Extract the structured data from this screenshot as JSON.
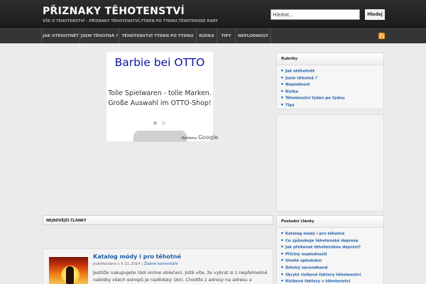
{
  "site": {
    "title": "PŘIZNAKY TĚHOTENSTVÍ",
    "tagline": "VŠE O TEHOTENSTVÍ - PŘÍZNAKY TĚHOTENSTVÍ,TÝDEN PO TÝDNU,TĚHOTENSKÉ RADY"
  },
  "search": {
    "value": "Hledat...",
    "button_label": "Hledej"
  },
  "nav": {
    "items": [
      "JAK OTĚHOTNĚT",
      "JSEM TĚHOTNÁ ?",
      "TĚHOTENSTVÍ TÝDEN PO TÝDNU",
      "RIZIKA",
      "TIPY",
      "NEPLODNOST"
    ],
    "rss_icon": "rss-icon"
  },
  "ad": {
    "title": "Barbie bei OTTO",
    "text": "Tolle Spielwaren - tolle Marken. Große Auswahl im OTTO-Shop!",
    "label": "Reklamy",
    "brand": "Google"
  },
  "sidebar": {
    "rubriky": {
      "title": "Rubriky",
      "items": [
        "Jak otěhotnět",
        "Jsem těhotná ?",
        "Neplodnost",
        "Rizika",
        "Těhotenství týden po týdnu",
        "Tipy"
      ]
    },
    "latest": {
      "title": "Poslední články",
      "items": [
        "Katalog módy i pro těhotné",
        "Co způsobuje těhotenské deprese",
        "Jak překonat těhotenskou depresi?",
        "Příčiny neplodnosti",
        "Umělé oplodnění",
        "Dětský secondhand",
        "Skryté rizikové faktory těhotenství",
        "Rizikové faktory v těhotenství"
      ]
    }
  },
  "main": {
    "section_title": "NEJNOVĚJŠÍ ČLÁNKY",
    "post": {
      "title": "Katalog módy i pro těhotné",
      "meta_prefix": "publikováno v 5.11.2014",
      "meta_sep": "|",
      "comments": "Žádné komentáře",
      "excerpt": "Jestliže nakupujete rádi online oblečení, jistě víte, že vybrat si z nepřehledné nabídky všech eshopů je nadlidský úkol. Chodíte z adresy na adresu a"
    }
  },
  "colors": {
    "header_bg": "#1f1f1f",
    "link": "#1f5ea8",
    "ad_title": "#0b139c",
    "rss": "#f49a1e"
  }
}
